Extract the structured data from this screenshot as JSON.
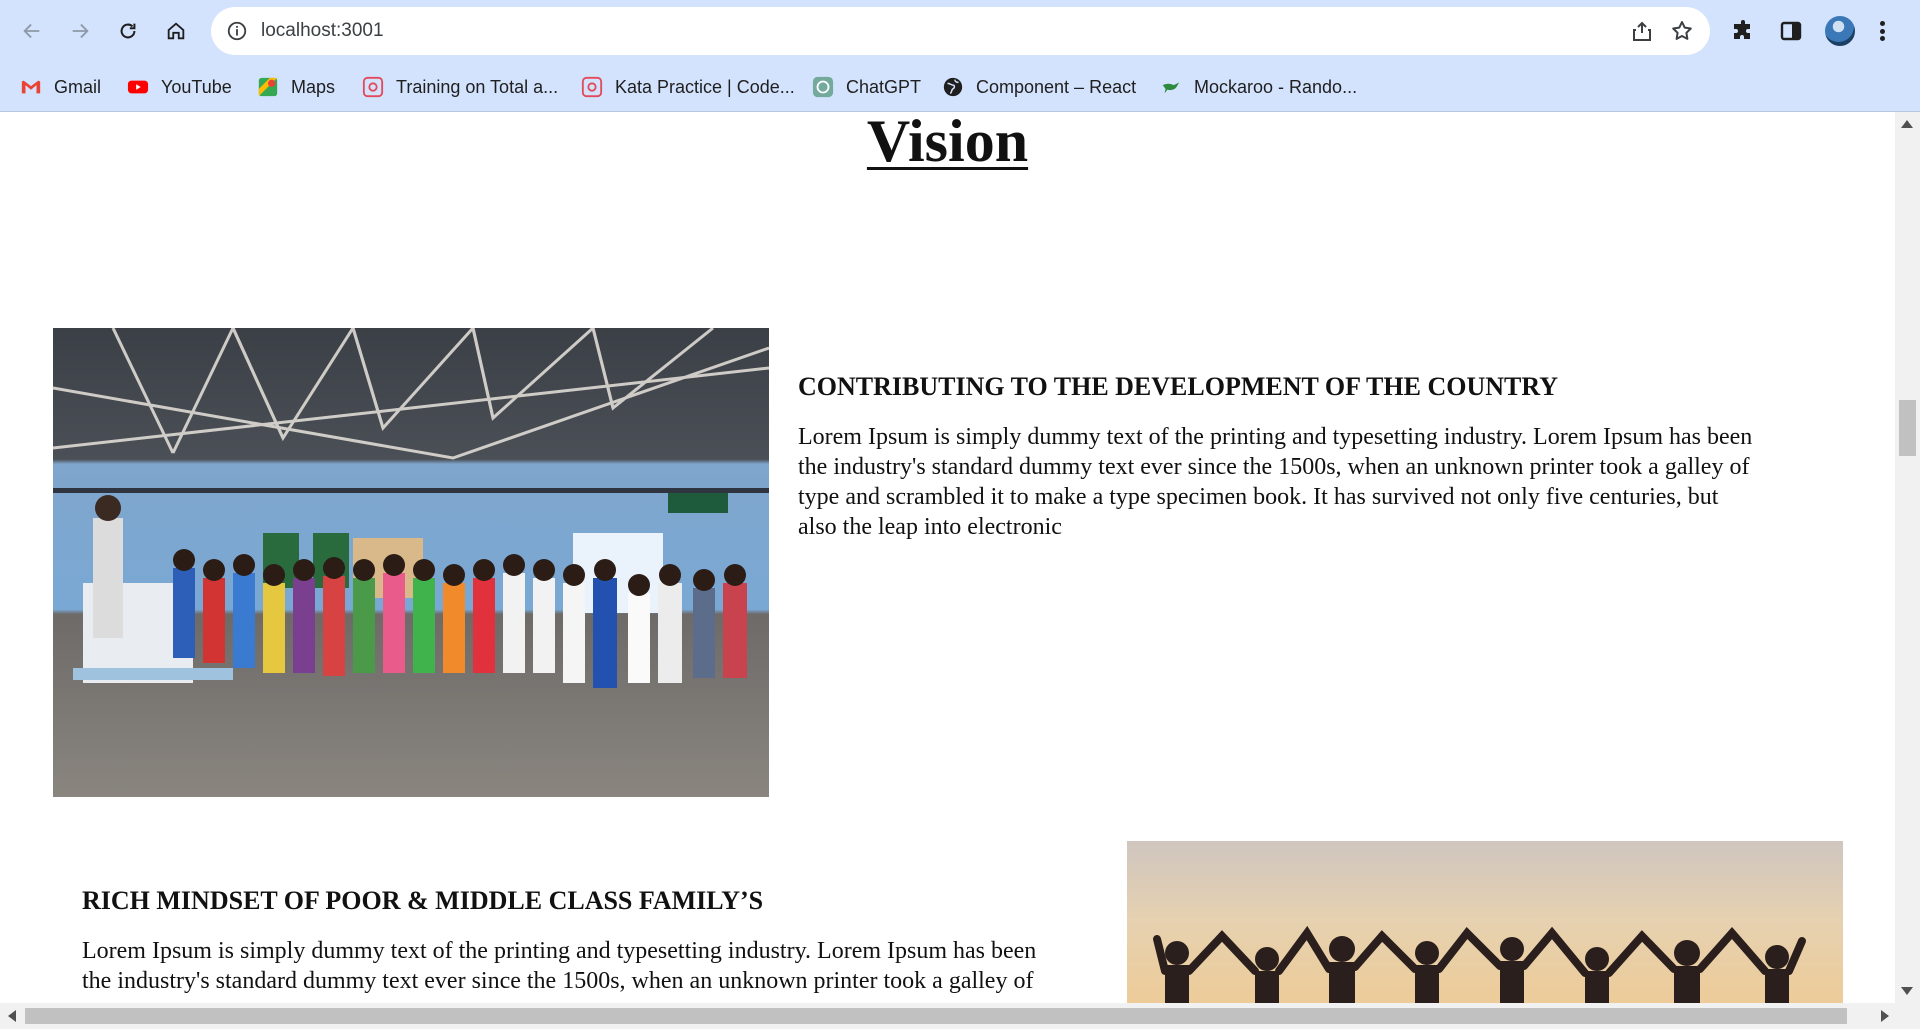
{
  "browser": {
    "url": "localhost:3001",
    "bookmarks": [
      {
        "label": "Gmail",
        "icon": "gmail-icon"
      },
      {
        "label": "YouTube",
        "icon": "youtube-icon"
      },
      {
        "label": "Maps",
        "icon": "maps-icon"
      },
      {
        "label": "Training on Total a...",
        "icon": "codesignal-icon"
      },
      {
        "label": "Kata Practice | Code...",
        "icon": "codesignal-icon"
      },
      {
        "label": "ChatGPT",
        "icon": "chatgpt-icon"
      },
      {
        "label": "Component – React",
        "icon": "globe-icon"
      },
      {
        "label": "Mockaroo - Rando...",
        "icon": "mockaroo-icon"
      }
    ]
  },
  "page": {
    "title": "Vision",
    "sections": [
      {
        "heading": "CONTRIBUTING TO THE DEVELOPMENT OF THE COUNTRY",
        "lines": [
          "Lorem Ipsum is simply dummy text of the printing and typesetting industry. Lorem Ipsum has been",
          "the industry's standard dummy text ever since the 1500s, when an unknown printer took a galley of",
          "type and scrambled it to make a type specimen book. It has survived not only five centuries, but",
          "also the leap into electronic"
        ]
      },
      {
        "heading": "RICH MINDSET OF POOR & MIDDLE CLASS FAMILY’S",
        "lines": [
          "Lorem Ipsum is simply dummy text of the printing and typesetting industry. Lorem Ipsum has been",
          "the industry's standard dummy text ever since the 1500s, when an unknown printer took a galley of"
        ]
      }
    ]
  },
  "colors": {
    "chrome": "#d3e3fd",
    "text": "#111111"
  }
}
